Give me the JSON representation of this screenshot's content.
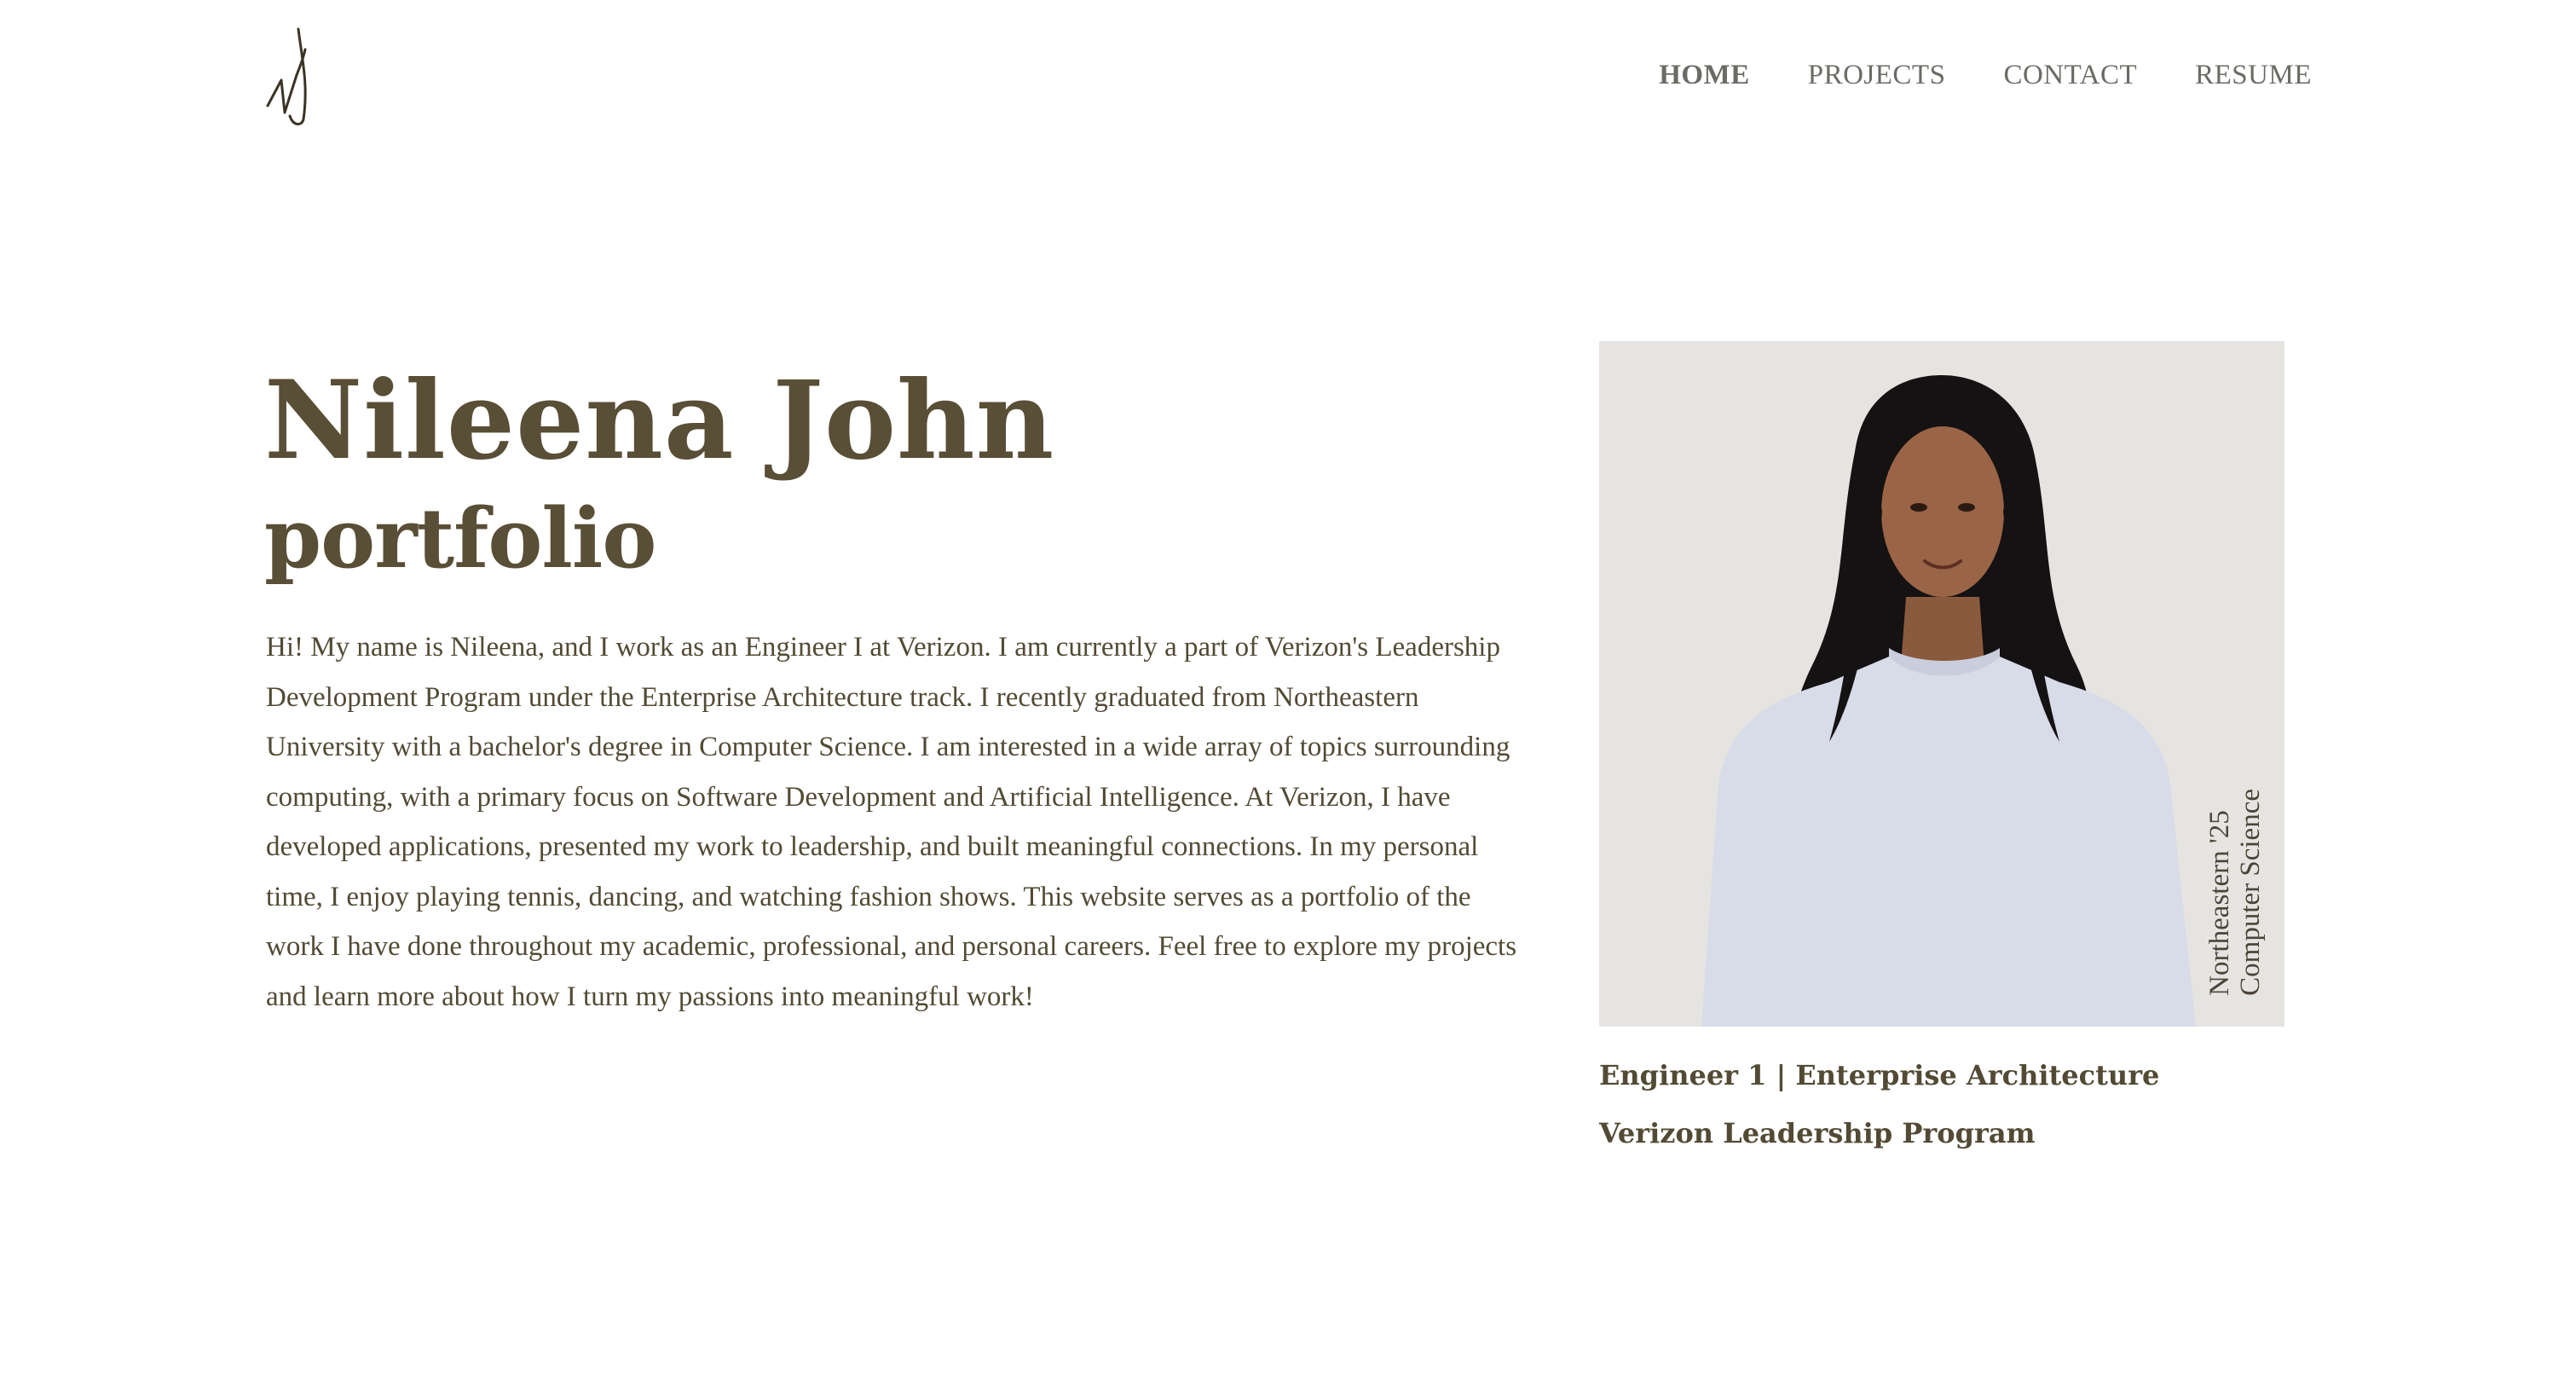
{
  "header": {
    "logo_text": "nJ",
    "nav": [
      {
        "label": "HOME",
        "active": true
      },
      {
        "label": "PROJECTS",
        "active": false
      },
      {
        "label": "CONTACT",
        "active": false
      },
      {
        "label": "RESUME",
        "active": false
      }
    ]
  },
  "hero": {
    "name": "Nileena John",
    "subtitle": "portfolio",
    "bio": "Hi! My name is Nileena, and I work as an Engineer I at Verizon. I am currently a part of Verizon's Leadership Development Program under the Enterprise Architecture track. I recently graduated from Northeastern University with a bachelor's degree in Computer Science. I am interested in a wide array of topics surrounding computing, with a primary focus on Software Development and Artificial Intelligence. At Verizon, I have developed applications, presented my work to leadership, and built meaningful connections. In my personal time, I enjoy playing tennis, dancing, and watching fashion shows. This website serves as a portfolio of the work I have done throughout my academic, professional, and personal careers. Feel free to explore my projects and learn more about how I turn my passions into meaningful work!"
  },
  "profile": {
    "caption_line1": "Northeastern '25",
    "caption_line2": "Computer Science",
    "role_title": "Engineer 1 | Enterprise Architecture",
    "program": "Verizon Leadership Program"
  },
  "colors": {
    "heading": "#594e36",
    "body_text": "#524a34",
    "nav_text": "#6b6b66",
    "photo_bg": "#e5e4e1"
  }
}
